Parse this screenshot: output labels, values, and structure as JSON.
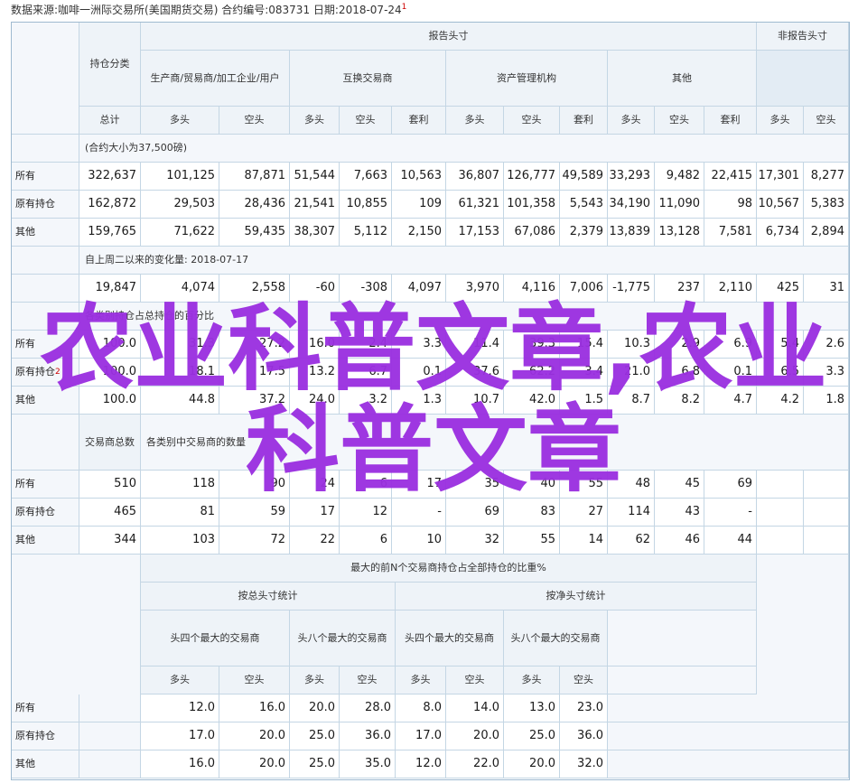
{
  "source_line": {
    "text": "数据来源:咖啡一洲际交易所(美国期货交易)   合约编号:083731   日期:2018-07-24",
    "marker": "1"
  },
  "header": {
    "report_group": "报告头寸",
    "nonreport_group": "非报告头寸",
    "holding_class": "持仓分类",
    "producer": "生产商/贸易商/加工企业/用户",
    "swap": "互换交易商",
    "managed": "资产管理机构",
    "other": "其他",
    "total": "总计",
    "long": "多头",
    "short": "空头",
    "spread": "套利"
  },
  "section1": {
    "note": "(合约大小为37,500磅)",
    "rows": [
      {
        "label": "所有",
        "values": [
          "322,637",
          "101,125",
          "87,871",
          "51,544",
          "7,663",
          "10,563",
          "36,807",
          "126,777",
          "49,589",
          "33,293",
          "9,482",
          "22,415",
          "17,301",
          "8,277"
        ]
      },
      {
        "label": "原有持仓",
        "values": [
          "162,872",
          "29,503",
          "28,436",
          "21,541",
          "10,855",
          "109",
          "61,321",
          "101,358",
          "5,543",
          "34,190",
          "11,090",
          "98",
          "10,567",
          "5,383"
        ]
      },
      {
        "label": "其他",
        "values": [
          "159,765",
          "71,622",
          "59,435",
          "38,307",
          "5,112",
          "2,150",
          "17,153",
          "67,086",
          "2,379",
          "13,839",
          "13,128",
          "7,581",
          "6,734",
          "2,894"
        ]
      }
    ]
  },
  "section2": {
    "note": "自上周二以来的变化量: 2018-07-17",
    "values": [
      "19,847",
      "4,074",
      "2,558",
      "-60",
      "-308",
      "4,097",
      "3,970",
      "4,116",
      "7,006",
      "-1,775",
      "237",
      "2,110",
      "425",
      "31"
    ]
  },
  "section3": {
    "note": "各类别持仓占总持仓的百分比",
    "rows": [
      {
        "label": "所有",
        "values": [
          "100.0",
          "31.3",
          "27.2",
          "16.0",
          "2.4",
          "3.3",
          "11.4",
          "39.3",
          "15.4",
          "10.3",
          "2.9",
          "6.9",
          "5.4",
          "2.6"
        ]
      },
      {
        "label": "原有持仓",
        "marker": "2",
        "values": [
          "100.0",
          "18.1",
          "17.5",
          "13.2",
          "6.7",
          "0.1",
          "37.6",
          "62.2",
          "3.4",
          "21.0",
          "6.8",
          "0.1",
          "6.5",
          "3.3"
        ]
      },
      {
        "label": "其他",
        "values": [
          "100.0",
          "44.8",
          "37.2",
          "24.0",
          "3.2",
          "1.3",
          "10.7",
          "42.0",
          "1.5",
          "8.7",
          "8.2",
          "4.7",
          "4.2",
          "1.8"
        ]
      }
    ]
  },
  "section4": {
    "header_left": "交易商总数",
    "note": "各类别中交易商的数量",
    "rows": [
      {
        "label": "所有",
        "values": [
          "510",
          "118",
          "90",
          "24",
          "6",
          "17",
          "35",
          "40",
          "55",
          "48",
          "45",
          "69",
          "",
          ""
        ]
      },
      {
        "label": "原有持仓",
        "values": [
          "465",
          "81",
          "59",
          "17",
          "12",
          "-",
          "69",
          "83",
          "27",
          "114",
          "43",
          "-",
          "",
          ""
        ]
      },
      {
        "label": "其他",
        "values": [
          "344",
          "103",
          "72",
          "22",
          "6",
          "10",
          "32",
          "55",
          "14",
          "62",
          "46",
          "44",
          "",
          ""
        ]
      }
    ]
  },
  "section5": {
    "title": "最大的前N个交易商持仓占全部持仓的比重%",
    "gross": "按总头寸统计",
    "net": "按净头寸统计",
    "top4": "头四个最大的交易商",
    "top8": "头八个最大的交易商",
    "long": "多头",
    "short": "空头",
    "rows": [
      {
        "label": "所有",
        "values": [
          "12.0",
          "16.0",
          "20.0",
          "28.0",
          "8.0",
          "14.0",
          "13.0",
          "23.0"
        ]
      },
      {
        "label": "原有持仓",
        "values": [
          "17.0",
          "20.0",
          "25.0",
          "36.0",
          "17.0",
          "20.0",
          "25.0",
          "36.0"
        ]
      },
      {
        "label": "其他",
        "values": [
          "16.0",
          "20.0",
          "25.0",
          "35.0",
          "12.0",
          "22.0",
          "20.0",
          "32.0"
        ]
      }
    ]
  },
  "watermark": {
    "text": "农业科普文章,农业科普文章",
    "color": "#9b30e0"
  },
  "colors": {
    "header_bg": "#eef3f8",
    "border": "#c4d6e4",
    "frame": "#9fbad0"
  }
}
